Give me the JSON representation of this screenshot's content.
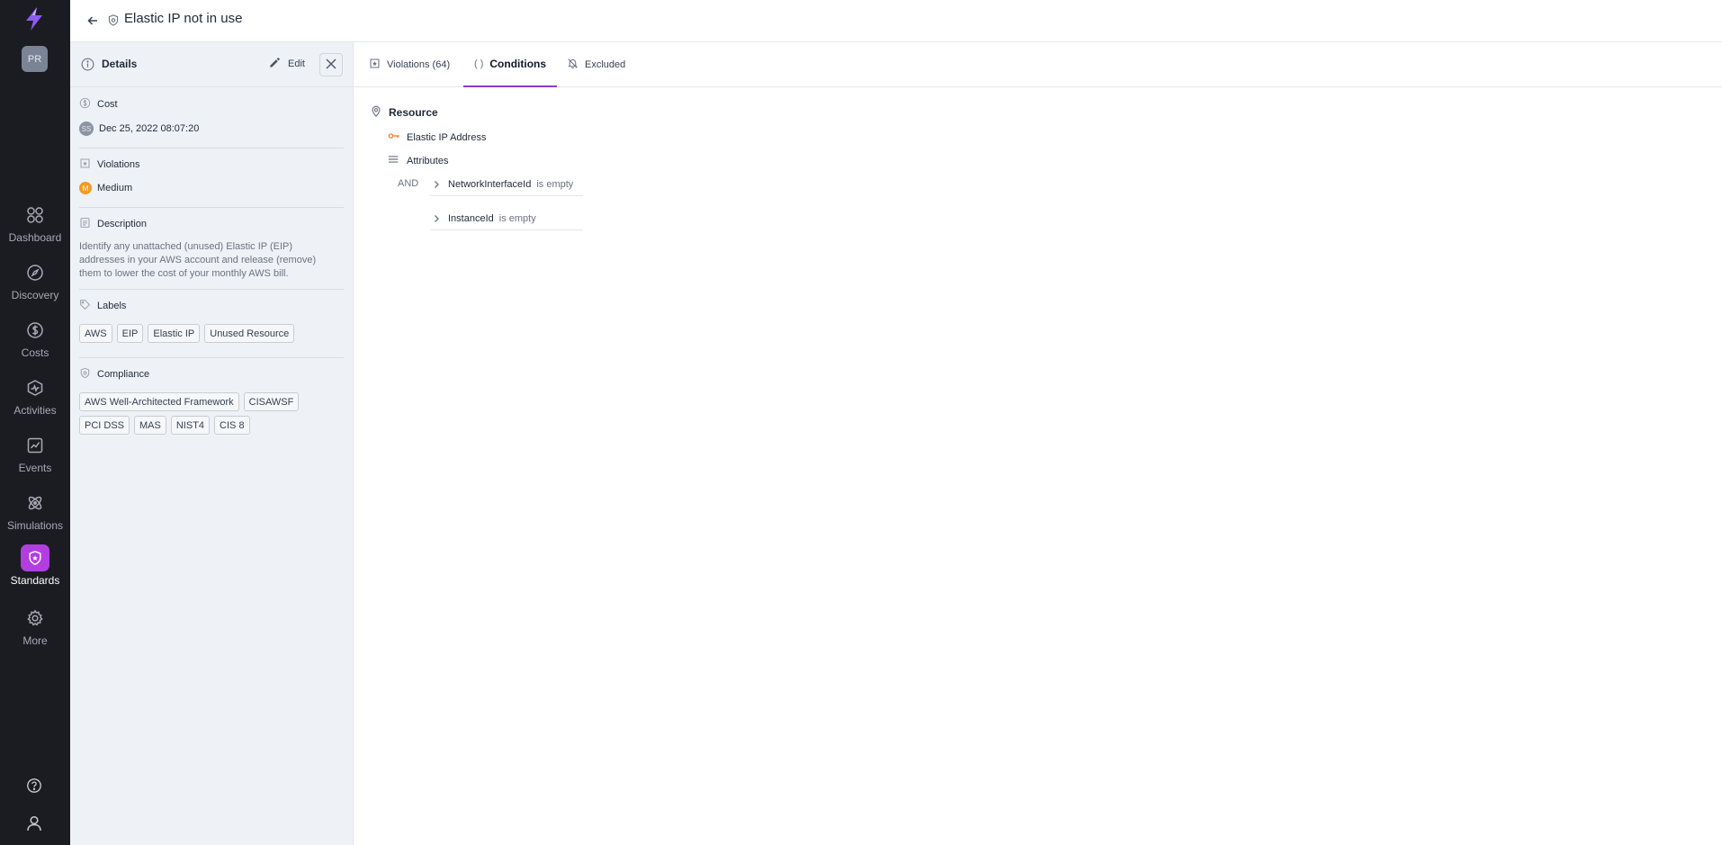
{
  "app": {
    "avatar_initials": "PR"
  },
  "nav": {
    "items": [
      {
        "label": "Dashboard",
        "icon": "dashboard-icon"
      },
      {
        "label": "Discovery",
        "icon": "compass-icon"
      },
      {
        "label": "Costs",
        "icon": "dollar-icon"
      },
      {
        "label": "Activities",
        "icon": "activity-icon"
      },
      {
        "label": "Events",
        "icon": "chart-icon"
      },
      {
        "label": "Simulations",
        "icon": "atom-icon"
      },
      {
        "label": "Standards",
        "icon": "shield-icon",
        "active": true
      },
      {
        "label": "More",
        "icon": "gear-icon"
      }
    ],
    "accent_color": "#b23ee0"
  },
  "header": {
    "title": "Elastic IP not in use"
  },
  "details": {
    "title": "Details",
    "edit_label": "Edit",
    "cost": {
      "heading": "Cost",
      "user_initials": "SS",
      "date": "Dec 25, 2022 08:07:20"
    },
    "violations": {
      "heading": "Violations",
      "severity_initial": "M",
      "severity": "Medium",
      "severity_color": "#f29b1d"
    },
    "description": {
      "heading": "Description",
      "lines": [
        "Identify any unattached (unused) Elastic IP (EIP)",
        "addresses in your AWS account and release (remove)",
        "them to lower the cost of your monthly AWS bill."
      ]
    },
    "labels": {
      "heading": "Labels",
      "items": [
        "AWS",
        "EIP",
        "Elastic IP",
        "Unused Resource"
      ]
    },
    "compliance": {
      "heading": "Compliance",
      "items": [
        "AWS Well-Architected Framework",
        "CISAWSF",
        "PCI DSS",
        "MAS",
        "NIST4",
        "CIS 8"
      ]
    }
  },
  "tabs": [
    {
      "label": "Violations (64)",
      "icon": "violations-icon"
    },
    {
      "label": "Conditions",
      "icon": "braces-icon",
      "active": true
    },
    {
      "label": "Excluded",
      "icon": "bell-off-icon"
    }
  ],
  "conditions": {
    "resource_heading": "Resource",
    "resource_type": "Elastic IP Address",
    "attributes_label": "Attributes",
    "logic": "AND",
    "rules": [
      {
        "field": "NetworkInterfaceId",
        "operator": "is empty"
      },
      {
        "field": "InstanceId",
        "operator": "is empty"
      }
    ]
  }
}
